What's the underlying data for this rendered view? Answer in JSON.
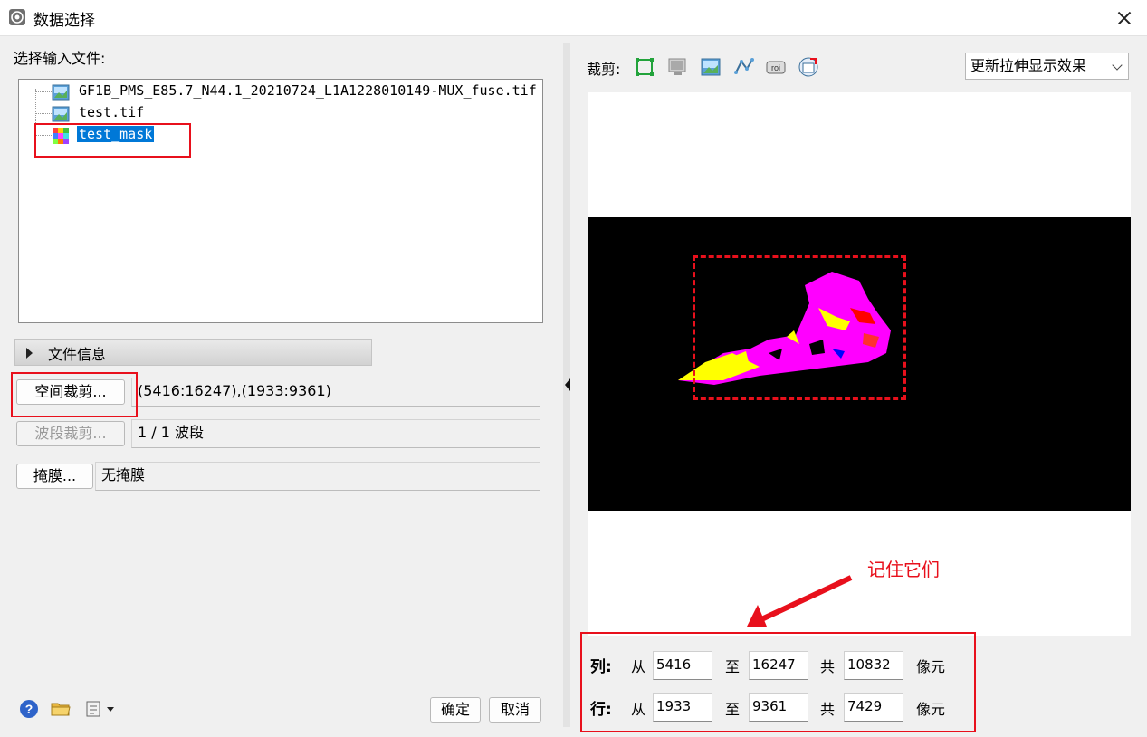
{
  "window": {
    "title": "数据选择"
  },
  "left": {
    "input_label": "选择输入文件:",
    "files": [
      {
        "name": "GF1B_PMS_E85.7_N44.1_20210724_L1A1228010149-MUX_fuse.tif",
        "icon": "raster-image-icon"
      },
      {
        "name": "test.tif",
        "icon": "raster-image-icon"
      },
      {
        "name": "test_mask",
        "icon": "classification-grid-icon",
        "selected": true
      }
    ],
    "file_info_label": "文件信息",
    "spatial_subset": {
      "button": "空间裁剪...",
      "value": "(5416:16247),(1933:9361)"
    },
    "spectral_subset": {
      "button": "波段裁剪...",
      "value": "1 / 1 波段"
    },
    "mask": {
      "button": "掩膜...",
      "value": "无掩膜"
    },
    "footer": {
      "ok": "确定",
      "cancel": "取消"
    }
  },
  "right": {
    "clip_label": "裁剪:",
    "toolbar_icons": [
      "full-extent-icon",
      "display-icon",
      "image-icon",
      "vector-icon",
      "roi-icon",
      "file-icon"
    ],
    "stretch_select": "更新拉伸显示效果",
    "annotation": "记住它们",
    "rows": [
      {
        "label": "列:",
        "from_label": "从",
        "from": "5416",
        "to_label": "至",
        "to": "16247",
        "total_label": "共",
        "total": "10832",
        "unit": "像元"
      },
      {
        "label": "行:",
        "from_label": "从",
        "from": "1933",
        "to_label": "至",
        "to": "9361",
        "total_label": "共",
        "total": "7429",
        "unit": "像元"
      }
    ]
  },
  "colors": {
    "accent_red": "#e8101c",
    "selection_blue": "#0078d7",
    "mask_magenta": "#ff00ff",
    "mask_yellow": "#ffff00"
  }
}
